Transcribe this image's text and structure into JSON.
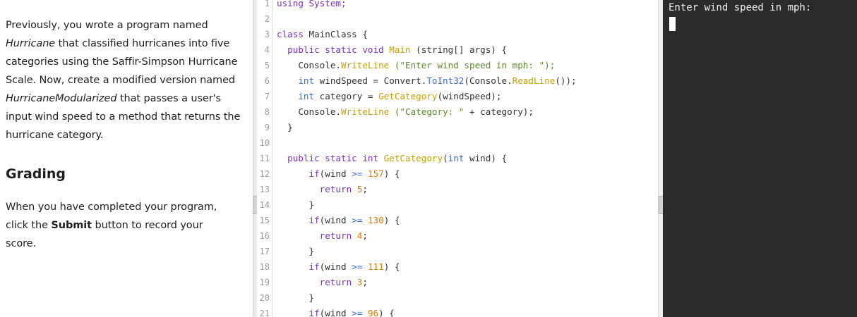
{
  "instructions": {
    "p1": {
      "t1": "Previously, you wrote a program named ",
      "em1": "Hurricane",
      "t2": " that classified hurricanes into five categories using the Saffir-Simpson Hurricane Scale. Now, create a modified version named ",
      "em2": "HurricaneModularized",
      "t3": " that passes a user's input wind speed to a method that returns the hurricane category."
    },
    "heading": "Grading",
    "p2": {
      "t1": "When you have completed your program, click the ",
      "strong": "Submit",
      "t2": " button to record your score."
    }
  },
  "editor": {
    "line_numbers": [
      "1",
      "2",
      "3",
      "4",
      "5",
      "6",
      "7",
      "8",
      "9",
      "10",
      "11",
      "12",
      "13",
      "14",
      "15",
      "16",
      "17",
      "18",
      "19",
      "20",
      "21"
    ],
    "code": [
      {
        "segments": [
          {
            "t": "using System;",
            "c": "kw"
          }
        ]
      },
      {
        "segments": [
          {
            "t": "",
            "c": ""
          }
        ]
      },
      {
        "segments": [
          {
            "t": "class",
            "c": "kw"
          },
          {
            "t": " MainClass {",
            "c": ""
          }
        ]
      },
      {
        "segments": [
          {
            "t": "  public static void ",
            "c": "kw"
          },
          {
            "t": "Main",
            "c": "fn"
          },
          {
            "t": " (string[] args) {",
            "c": ""
          }
        ]
      },
      {
        "segments": [
          {
            "t": "    Console.",
            "c": ""
          },
          {
            "t": "WriteLine",
            "c": "fn"
          },
          {
            "t": " (\"Enter wind speed in mph: \");",
            "c": "str"
          }
        ]
      },
      {
        "segments": [
          {
            "t": "    int",
            "c": "ty"
          },
          {
            "t": " windSpeed = Convert.",
            "c": ""
          },
          {
            "t": "ToInt32",
            "c": "mem"
          },
          {
            "t": "(Console.",
            "c": ""
          },
          {
            "t": "ReadLine",
            "c": "fn"
          },
          {
            "t": "());",
            "c": ""
          }
        ]
      },
      {
        "segments": [
          {
            "t": "    int",
            "c": "ty"
          },
          {
            "t": " category = ",
            "c": ""
          },
          {
            "t": "GetCategory",
            "c": "fn"
          },
          {
            "t": "(windSpeed);",
            "c": ""
          }
        ]
      },
      {
        "segments": [
          {
            "t": "    Console.",
            "c": ""
          },
          {
            "t": "WriteLine",
            "c": "fn"
          },
          {
            "t": " (\"Category: \"",
            "c": "str"
          },
          {
            "t": " + category);",
            "c": ""
          }
        ]
      },
      {
        "segments": [
          {
            "t": "  }",
            "c": ""
          }
        ]
      },
      {
        "segments": [
          {
            "t": "",
            "c": ""
          }
        ]
      },
      {
        "segments": [
          {
            "t": "  public static int ",
            "c": "kw"
          },
          {
            "t": "GetCategory",
            "c": "fn"
          },
          {
            "t": "(",
            "c": ""
          },
          {
            "t": "int",
            "c": "ty"
          },
          {
            "t": " wind) {",
            "c": ""
          }
        ]
      },
      {
        "segments": [
          {
            "t": "      if",
            "c": "kw"
          },
          {
            "t": "(wind ",
            "c": ""
          },
          {
            "t": ">=",
            "c": "ty"
          },
          {
            "t": " ",
            "c": ""
          },
          {
            "t": "157",
            "c": "num"
          },
          {
            "t": ") {",
            "c": ""
          }
        ]
      },
      {
        "segments": [
          {
            "t": "        return",
            "c": "kw"
          },
          {
            "t": " ",
            "c": ""
          },
          {
            "t": "5",
            "c": "num"
          },
          {
            "t": ";",
            "c": ""
          }
        ]
      },
      {
        "segments": [
          {
            "t": "      }",
            "c": ""
          }
        ]
      },
      {
        "segments": [
          {
            "t": "      if",
            "c": "kw"
          },
          {
            "t": "(wind ",
            "c": ""
          },
          {
            "t": ">=",
            "c": "ty"
          },
          {
            "t": " ",
            "c": ""
          },
          {
            "t": "130",
            "c": "num"
          },
          {
            "t": ") {",
            "c": ""
          }
        ]
      },
      {
        "segments": [
          {
            "t": "        return",
            "c": "kw"
          },
          {
            "t": " ",
            "c": ""
          },
          {
            "t": "4",
            "c": "num"
          },
          {
            "t": ";",
            "c": ""
          }
        ]
      },
      {
        "segments": [
          {
            "t": "      }",
            "c": ""
          }
        ]
      },
      {
        "segments": [
          {
            "t": "      if",
            "c": "kw"
          },
          {
            "t": "(wind ",
            "c": ""
          },
          {
            "t": ">=",
            "c": "ty"
          },
          {
            "t": " ",
            "c": ""
          },
          {
            "t": "111",
            "c": "num"
          },
          {
            "t": ") {",
            "c": ""
          }
        ]
      },
      {
        "segments": [
          {
            "t": "        return",
            "c": "kw"
          },
          {
            "t": " ",
            "c": ""
          },
          {
            "t": "3",
            "c": "num"
          },
          {
            "t": ";",
            "c": ""
          }
        ]
      },
      {
        "segments": [
          {
            "t": "      }",
            "c": ""
          }
        ]
      },
      {
        "segments": [
          {
            "t": "      if",
            "c": "kw"
          },
          {
            "t": "(wind ",
            "c": ""
          },
          {
            "t": ">=",
            "c": "ty"
          },
          {
            "t": " ",
            "c": ""
          },
          {
            "t": "96",
            "c": "num"
          },
          {
            "t": ") {",
            "c": ""
          }
        ]
      }
    ]
  },
  "console": {
    "output": "Enter wind speed in mph:"
  },
  "colors": {
    "keyword": "#7b30b8",
    "type": "#3b6cc8",
    "function": "#c8a000",
    "number": "#e07b00",
    "string": "#5b8a2e",
    "console_bg": "#2b2b2b"
  }
}
